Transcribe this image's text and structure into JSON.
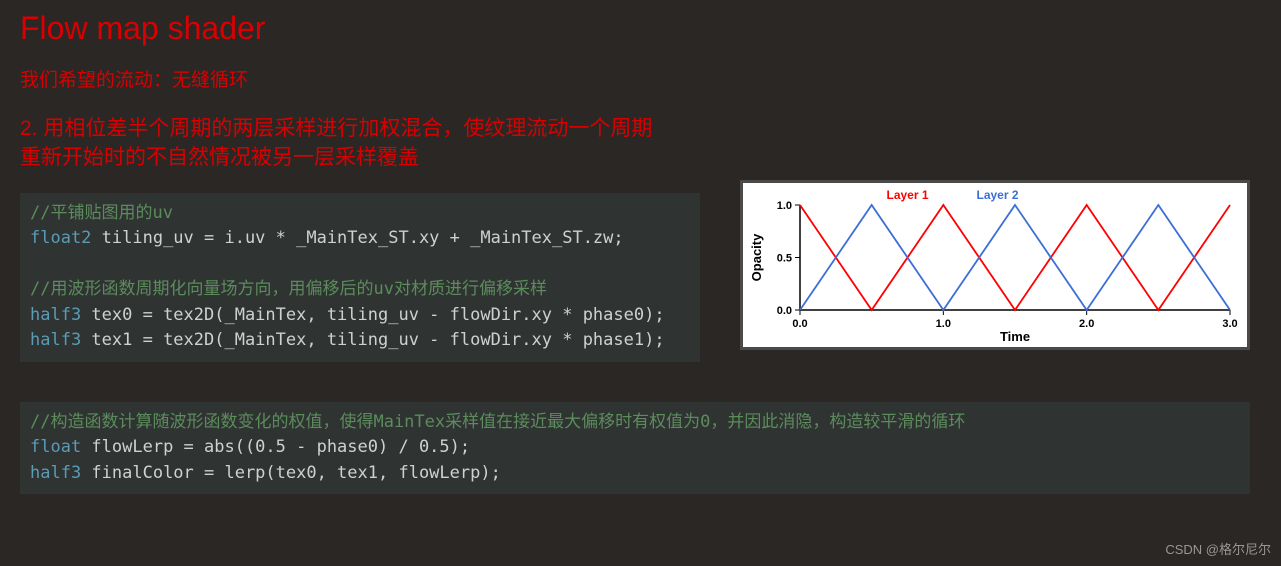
{
  "title": "Flow map shader",
  "sub1": "我们希望的流动：无缝循环",
  "sub2": "2. 用相位差半个周期的两层采样进行加权混合，使纹理流动一个周期重新开始时的不自然情况被另一层采样覆盖",
  "code1": {
    "c1": "//平铺贴图用的uv",
    "l1_kw": "float2",
    "l1_rest": " tiling_uv = i.uv * _MainTex_ST.xy + _MainTex_ST.zw;",
    "c2": "//用波形函数周期化向量场方向，用偏移后的uv对材质进行偏移采样",
    "l2_kw": "half3",
    "l2_rest": " tex0 = tex2D(_MainTex, tiling_uv - flowDir.xy * phase0);",
    "l3_kw": "half3",
    "l3_rest": " tex1 = tex2D(_MainTex, tiling_uv - flowDir.xy * phase1);"
  },
  "code2": {
    "c1": "//构造函数计算随波形函数变化的权值，使得MainTex采样值在接近最大偏移时有权值为0，并因此消隐，构造较平滑的循环",
    "l1_kw": "float",
    "l1_rest": " flowLerp = abs((0.5 - phase0) / 0.5);",
    "l2_kw": "half3",
    "l2_rest": " finalColor = lerp(tex0, tex1, flowLerp);"
  },
  "chart_data": {
    "type": "line",
    "title": "",
    "xlabel": "Time",
    "ylabel": "Opacity",
    "x": [
      0.0,
      0.5,
      1.0,
      1.5,
      2.0,
      2.5,
      3.0
    ],
    "xlim": [
      0.0,
      3.0
    ],
    "ylim": [
      0.0,
      1.0
    ],
    "xticks": [
      0.0,
      1.0,
      2.0,
      3.0
    ],
    "yticks": [
      0.0,
      0.5,
      1.0
    ],
    "series": [
      {
        "name": "Layer 1",
        "color": "#ff0000",
        "values": [
          1.0,
          0.0,
          1.0,
          0.0,
          1.0,
          0.0,
          1.0
        ]
      },
      {
        "name": "Layer 2",
        "color": "#3b6fd6",
        "values": [
          0.0,
          1.0,
          0.0,
          1.0,
          0.0,
          1.0,
          0.0
        ]
      }
    ],
    "legend": [
      "Layer 1",
      "Layer 2"
    ]
  },
  "watermark": "CSDN @格尔尼尔"
}
